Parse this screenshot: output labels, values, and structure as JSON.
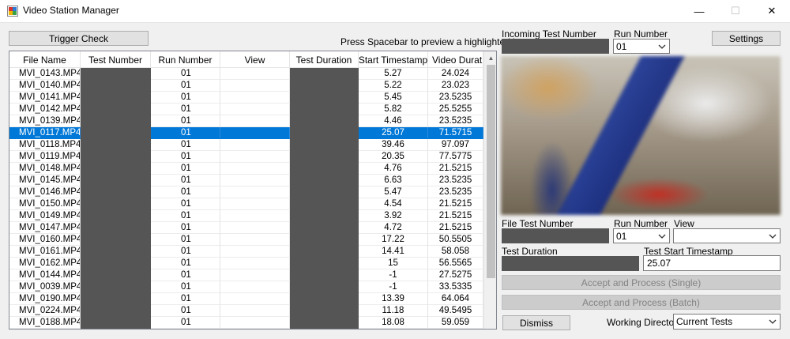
{
  "window": {
    "title": "Video Station Manager",
    "minimize_glyph": "—",
    "maximize_glyph": "☐",
    "close_glyph": "✕"
  },
  "toolbar": {
    "trigger_check_label": "Trigger Check",
    "hint_text": "Press Spacebar to preview a highlighted image"
  },
  "table": {
    "columns": [
      "File Name",
      "Test Number",
      "Run Number",
      "View",
      "Test Duration",
      "Start Timestamp",
      "Video Durat..."
    ],
    "selected_row": 5,
    "rows": [
      {
        "file": "MVI_0143.MP4",
        "run": "01",
        "start": "5.27",
        "vdur": "24.024"
      },
      {
        "file": "MVI_0140.MP4",
        "run": "01",
        "start": "5.22",
        "vdur": "23.023"
      },
      {
        "file": "MVI_0141.MP4",
        "run": "01",
        "start": "5.45",
        "vdur": "23.5235"
      },
      {
        "file": "MVI_0142.MP4",
        "run": "01",
        "start": "5.82",
        "vdur": "25.5255"
      },
      {
        "file": "MVI_0139.MP4",
        "run": "01",
        "start": "4.46",
        "vdur": "23.5235"
      },
      {
        "file": "MVI_0117.MP4",
        "run": "01",
        "start": "25.07",
        "vdur": "71.5715"
      },
      {
        "file": "MVI_0118.MP4",
        "run": "01",
        "start": "39.46",
        "vdur": "97.097"
      },
      {
        "file": "MVI_0119.MP4",
        "run": "01",
        "start": "20.35",
        "vdur": "77.5775"
      },
      {
        "file": "MVI_0148.MP4",
        "run": "01",
        "start": "4.76",
        "vdur": "21.5215"
      },
      {
        "file": "MVI_0145.MP4",
        "run": "01",
        "start": "6.63",
        "vdur": "23.5235"
      },
      {
        "file": "MVI_0146.MP4",
        "run": "01",
        "start": "5.47",
        "vdur": "23.5235"
      },
      {
        "file": "MVI_0150.MP4",
        "run": "01",
        "start": "4.54",
        "vdur": "21.5215"
      },
      {
        "file": "MVI_0149.MP4",
        "run": "01",
        "start": "3.92",
        "vdur": "21.5215"
      },
      {
        "file": "MVI_0147.MP4",
        "run": "01",
        "start": "4.72",
        "vdur": "21.5215"
      },
      {
        "file": "MVI_0160.MP4",
        "run": "01",
        "start": "17.22",
        "vdur": "50.5505"
      },
      {
        "file": "MVI_0161.MP4",
        "run": "01",
        "start": "14.41",
        "vdur": "58.058"
      },
      {
        "file": "MVI_0162.MP4",
        "run": "01",
        "start": "15",
        "vdur": "56.5565"
      },
      {
        "file": "MVI_0144.MP4",
        "run": "01",
        "start": "-1",
        "vdur": "27.5275"
      },
      {
        "file": "MVI_0039.MP4",
        "run": "01",
        "start": "-1",
        "vdur": "33.5335"
      },
      {
        "file": "MVI_0190.MP4",
        "run": "01",
        "start": "13.39",
        "vdur": "64.064"
      },
      {
        "file": "MVI_0224.MP4",
        "run": "01",
        "start": "11.18",
        "vdur": "49.5495"
      },
      {
        "file": "MVI_0188.MP4",
        "run": "01",
        "start": "18.08",
        "vdur": "59.059"
      }
    ]
  },
  "right_panel": {
    "incoming_test_number_label": "Incoming Test Number",
    "run_number_label": "Run Number",
    "run_number_value": "01",
    "settings_label": "Settings",
    "file_test_number_label": "File Test Number",
    "file_run_number_label": "Run Number",
    "file_run_number_value": "01",
    "view_label": "View",
    "view_value": "",
    "test_duration_label": "Test Duration",
    "test_start_timestamp_label": "Test Start Timestamp",
    "test_start_timestamp_value": "25.07",
    "accept_single_label": "Accept and Process (Single)",
    "accept_batch_label": "Accept and Process (Batch)",
    "dismiss_label": "Dismiss",
    "working_directory_label": "Working Directory",
    "working_directory_value": "Current Tests"
  },
  "colors": {
    "selection": "#0078d7",
    "redacted": "#555555",
    "window_bg": "#f0f0f0"
  }
}
